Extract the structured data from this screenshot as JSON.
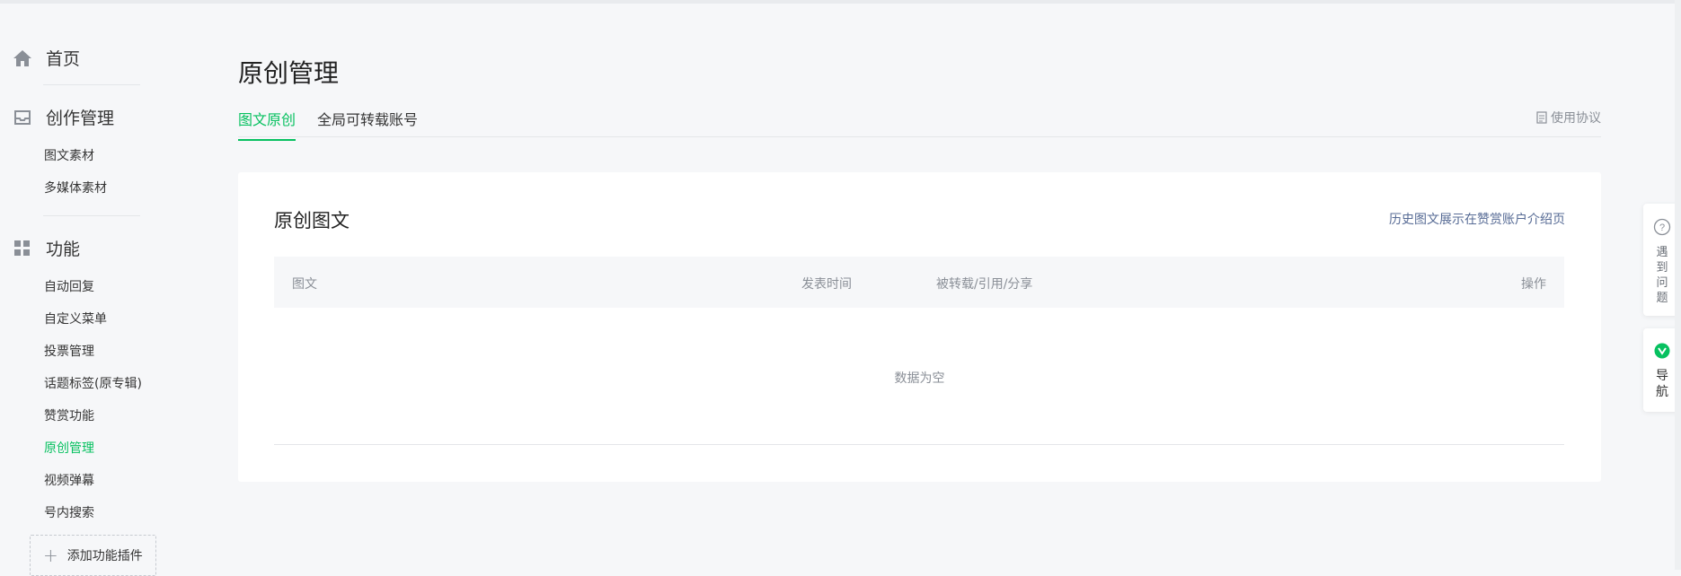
{
  "sidebar": {
    "home": {
      "label": "首页",
      "icon": "home-icon"
    },
    "creation": {
      "label": "创作管理",
      "icon": "inbox-icon",
      "items": [
        {
          "label": "图文素材"
        },
        {
          "label": "多媒体素材"
        }
      ]
    },
    "features": {
      "label": "功能",
      "icon": "grid-icon",
      "items": [
        {
          "label": "自动回复"
        },
        {
          "label": "自定义菜单"
        },
        {
          "label": "投票管理"
        },
        {
          "label": "话题标签(原专辑)"
        },
        {
          "label": "赞赏功能"
        },
        {
          "label": "原创管理",
          "active": true
        },
        {
          "label": "视频弹幕"
        },
        {
          "label": "号内搜索"
        }
      ]
    },
    "add_plugin_label": "添加功能插件"
  },
  "main": {
    "title": "原创管理",
    "tabs": [
      {
        "label": "图文原创",
        "active": true
      },
      {
        "label": "全局可转载账号"
      }
    ],
    "agreement_label": "使用协议",
    "card": {
      "title": "原创图文",
      "link": "历史图文展示在赞赏账户介绍页",
      "columns": {
        "article": "图文",
        "publish_time": "发表时间",
        "reprint": "被转载/引用/分享",
        "actions": "操作"
      },
      "empty_text": "数据为空"
    }
  },
  "floating": {
    "help_label": "遇到问题",
    "nav_label": "导航"
  },
  "colors": {
    "accent": "#07c160",
    "link": "#576b95",
    "muted": "#8a8f97"
  }
}
